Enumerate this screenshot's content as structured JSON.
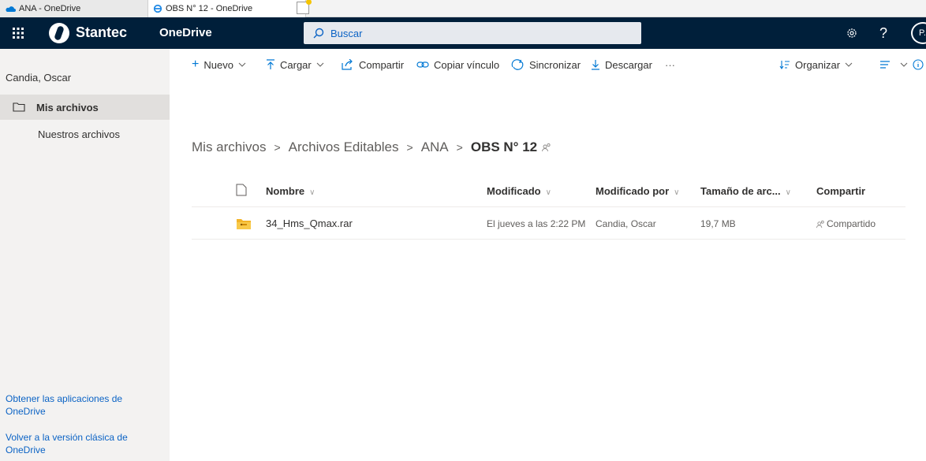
{
  "browser": {
    "tabs": [
      {
        "title": "ANA - OneDrive"
      },
      {
        "title": "OBS N° 12 - OneDrive"
      }
    ],
    "close_glyph": "×"
  },
  "header": {
    "brand": "Stantec",
    "app_name": "OneDrive",
    "search_placeholder": "Buscar",
    "help_glyph": "?",
    "avatar_initials": "P."
  },
  "sidebar": {
    "user_name": "Candia, Oscar",
    "items": [
      {
        "label": "Mis archivos"
      },
      {
        "label": "Nuestros archivos"
      }
    ],
    "links": [
      {
        "label": "Obtener las aplicaciones de OneDrive"
      },
      {
        "label": "Volver a la versión clásica de OneDrive"
      }
    ]
  },
  "commands": {
    "nuevo": "Nuevo",
    "cargar": "Cargar",
    "compartir": "Compartir",
    "copiar": "Copiar vínculo",
    "sincronizar": "Sincronizar",
    "descargar": "Descargar",
    "more": "···",
    "organizar": "Organizar"
  },
  "breadcrumb": {
    "items": [
      "Mis archivos",
      "Archivos Editables",
      "ANA"
    ],
    "current": "OBS N° 12",
    "separator": ">"
  },
  "list": {
    "columns": {
      "name": "Nombre",
      "modified": "Modificado",
      "modified_by": "Modificado por",
      "size": "Tamaño de arc...",
      "sharing": "Compartir"
    },
    "rows": [
      {
        "name": "34_Hms_Qmax.rar",
        "modified": "El jueves a las 2:22 PM",
        "modified_by": "Candia, Oscar",
        "size": "19,7 MB",
        "sharing": "Compartido"
      }
    ]
  },
  "colors": {
    "suite_bar": "#001f3a",
    "accent": "#0078d4",
    "link": "#0b63c5",
    "folder": "#f3b428"
  }
}
